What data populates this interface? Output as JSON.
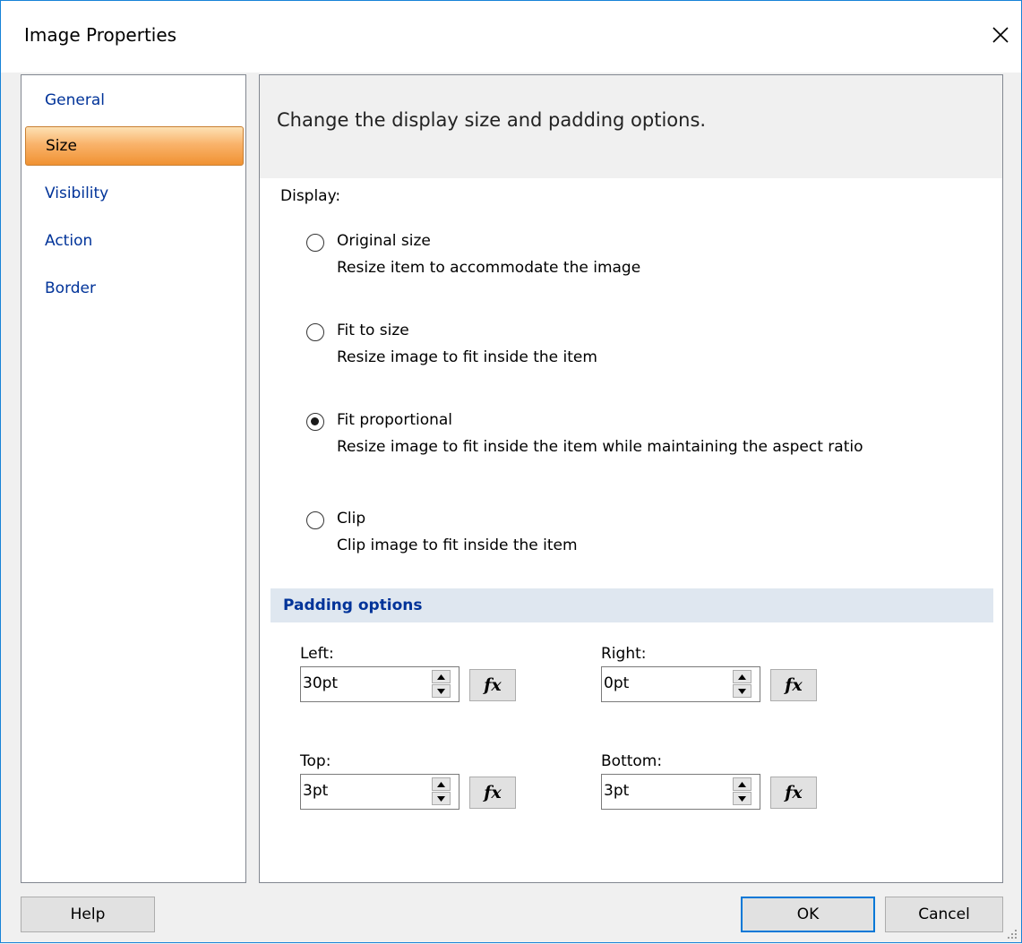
{
  "window": {
    "title": "Image Properties"
  },
  "nav": {
    "items": [
      {
        "label": "General",
        "selected": false
      },
      {
        "label": "Size",
        "selected": true
      },
      {
        "label": "Visibility",
        "selected": false
      },
      {
        "label": "Action",
        "selected": false
      },
      {
        "label": "Border",
        "selected": false
      }
    ]
  },
  "panel": {
    "header": "Change the display size and padding options.",
    "display_label": "Display:",
    "options": [
      {
        "title": "Original size",
        "description": "Resize item to accommodate the image",
        "checked": false
      },
      {
        "title": "Fit to size",
        "description": "Resize image to fit inside the item",
        "checked": false
      },
      {
        "title": "Fit proportional",
        "description": "Resize image to fit inside the item while maintaining the aspect ratio",
        "checked": true
      },
      {
        "title": "Clip",
        "description": "Clip image to fit inside the item",
        "checked": false
      }
    ],
    "padding": {
      "section_label": "Padding options",
      "left": {
        "label": "Left:",
        "value": "30pt"
      },
      "right": {
        "label": "Right:",
        "value": "0pt"
      },
      "top": {
        "label": "Top:",
        "value": "3pt"
      },
      "bottom": {
        "label": "Bottom:",
        "value": "3pt"
      },
      "fx_label": "fx"
    }
  },
  "buttons": {
    "help": "Help",
    "ok": "OK",
    "cancel": "Cancel"
  },
  "colors": {
    "nav_selected": "#f9b36b",
    "link_text": "#003399",
    "section_bg": "#dfe7f0",
    "default_button_border": "#0078d7"
  },
  "icons": {
    "close": "close-icon",
    "spin_up": "spin-up-icon",
    "spin_down": "spin-down-icon",
    "expression": "fx-icon",
    "resize": "resize-grip-icon"
  }
}
